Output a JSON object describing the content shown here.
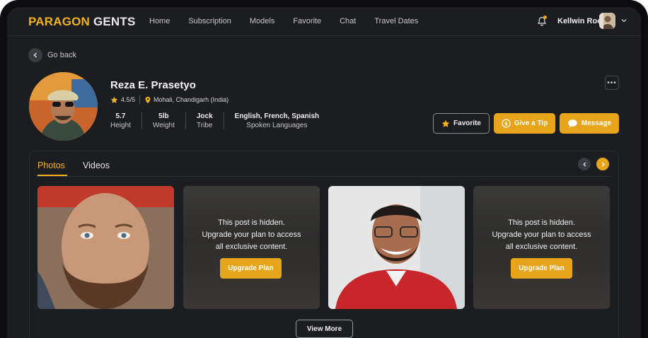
{
  "brand": {
    "part1": "PARAGON",
    "part2": "GENTS",
    "accent": "#f2b21a"
  },
  "nav": [
    {
      "label": "Home"
    },
    {
      "label": "Subscription"
    },
    {
      "label": "Models"
    },
    {
      "label": "Favorite"
    },
    {
      "label": "Chat"
    },
    {
      "label": "Travel Dates"
    }
  ],
  "user": {
    "name": "Kellwin Roe"
  },
  "back": {
    "label": "Go back"
  },
  "profile": {
    "name": "Reza E. Prasetyo",
    "rating": "4.5/5",
    "location": "Mohali, Chandigarh (India)",
    "stats": [
      {
        "value": "5.7",
        "label": "Height"
      },
      {
        "value": "5lb",
        "label": "Weight"
      },
      {
        "value": "Jock",
        "label": "Tribe"
      },
      {
        "value": "English, French, Spanish",
        "label": "Spoken Languages"
      }
    ]
  },
  "actions": {
    "more": "•••",
    "favorite": "Favorite",
    "tip": "Give a Tip",
    "message": "Message"
  },
  "tabs": [
    {
      "label": "Photos",
      "active": true
    },
    {
      "label": "Videos",
      "active": false
    }
  ],
  "hidden_post": {
    "line1": "This post is hidden.",
    "line2": "Upgrade your plan to access",
    "line3": "all exclusive content.",
    "button": "Upgrade Plan"
  },
  "view_more": "View More",
  "colors": {
    "background": "#1c1d21",
    "accent": "#e6a51b"
  }
}
